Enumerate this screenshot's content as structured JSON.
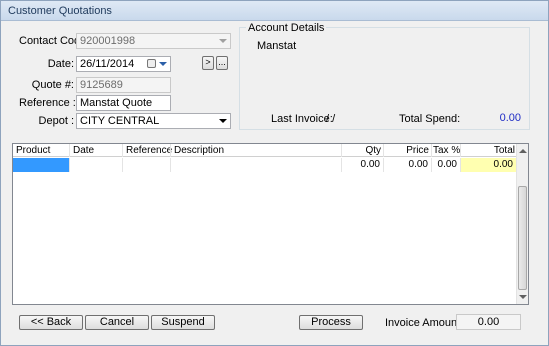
{
  "window": {
    "title": "Customer Quotations"
  },
  "form": {
    "contact_code_label": "Contact Code :",
    "contact_code_value": "920001998",
    "date_label": "Date:",
    "date_value": "26/11/2014",
    "quote_label": "Quote #:",
    "quote_value": "9125689",
    "reference_label": "Reference :",
    "reference_value": "Manstat Quote",
    "depot_label": "Depot :",
    "depot_value": "CITY CENTRAL",
    "next_btn": ">",
    "more_btn": "..."
  },
  "account": {
    "legend": "Account Details",
    "name": "Manstat",
    "last_invoice_label": "Last Invoice:",
    "last_invoice_value": "/ /",
    "total_spend_label": "Total Spend:",
    "total_spend_value": "0.00",
    "total_spend_color": "#1f2cc4"
  },
  "grid": {
    "columns": [
      "Product",
      "Date",
      "Reference",
      "Description",
      "Qty",
      "Price",
      "Tax %",
      "Total"
    ],
    "rows": [
      {
        "product": "",
        "date": "",
        "reference": "",
        "description": "",
        "qty": "0.00",
        "price": "0.00",
        "tax": "0.00",
        "total": "0.00"
      }
    ],
    "selected_color": "#3399ff",
    "total_cell_color": "#ffffb0"
  },
  "footer": {
    "back": "<< Back",
    "cancel": "Cancel",
    "suspend": "Suspend",
    "process": "Process",
    "invoice_amount_label": "Invoice Amount :",
    "invoice_amount_value": "0.00"
  }
}
